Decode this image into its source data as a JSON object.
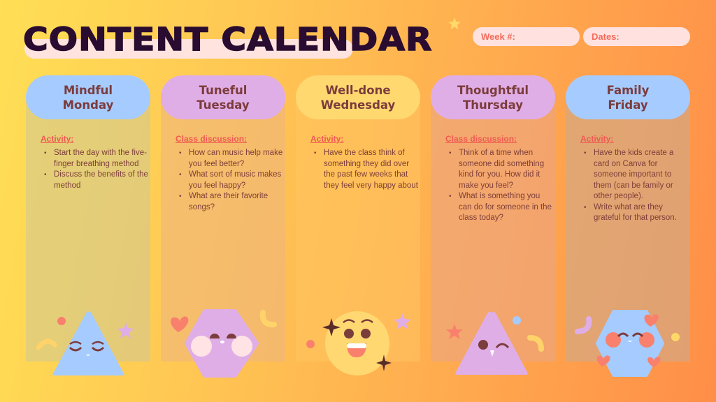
{
  "header": {
    "title": "CONTENT CALENDAR",
    "week_label": "Week #:",
    "dates_label": "Dates:"
  },
  "colors": {
    "background_start": "#ffdf55",
    "background_end": "#ff8e48",
    "title": "#2a0c30",
    "heading_text": "#7b3c3c",
    "section_label": "#f05a52",
    "body_text": "#7d3e3a",
    "pill_bg": "#ffe2df",
    "pill_text": "#f46a5a"
  },
  "days": [
    {
      "title_line1": "Mindful",
      "title_line2": "Monday",
      "section": "Activity:",
      "header_color": "#a6cbff",
      "body_color": "#e3cd7c",
      "items": [
        "Start the day with the five-finger breathing method",
        "Discuss the benefits of the method"
      ],
      "mascot": "blue-triangle-sleepy"
    },
    {
      "title_line1": "Tuneful",
      "title_line2": "Tuesday",
      "section": "Class discussion:",
      "header_color": "#e0aee6",
      "body_color": "#f6bb78",
      "items": [
        "How can music help make you feel better?",
        "What sort of music makes you feel happy?",
        "What are their favorite songs?"
      ],
      "mascot": "purple-hexagon-blushing"
    },
    {
      "title_line1": "Well-done",
      "title_line2": "Wednesday",
      "section": "Activity:",
      "header_color": "#ffd870",
      "body_color": "#ffbd59",
      "items": [
        "Have the class think of something they did over the past few weeks that they feel very happy about"
      ],
      "mascot": "yellow-circle-laughing"
    },
    {
      "title_line1": "Thoughtful",
      "title_line2": "Thursday",
      "section": "Class discussion:",
      "header_color": "#e0aee6",
      "body_color": "#f5a676",
      "items": [
        "Think of a time when someone did something kind for you. How did it make you feel?",
        "What is something you can do for someone in the class today?"
      ],
      "mascot": "purple-triangle-winking"
    },
    {
      "title_line1": "Family",
      "title_line2": "Friday",
      "section": "Activity:",
      "header_color": "#a6cbff",
      "body_color": "#e7a379",
      "items": [
        "Have the kids create a card on Canva for someone important to them (can be family or other people).",
        "Write what are they grateful for that person."
      ],
      "mascot": "blue-hexagon-hearts"
    }
  ]
}
